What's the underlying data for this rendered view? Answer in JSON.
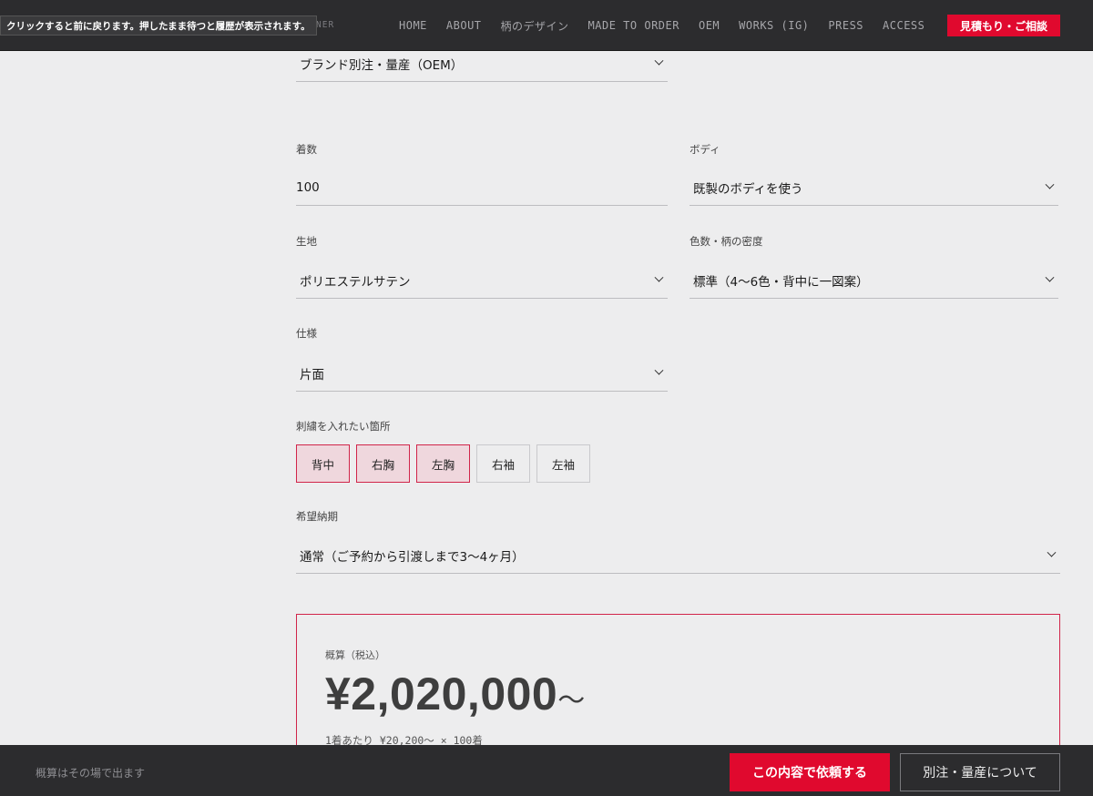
{
  "tooltip": "クリックすると前に戻ります。押したまま待つと履歴が表示されます。",
  "brand_tail": "N DESIGNER",
  "nav": {
    "items": [
      {
        "label": "HOME"
      },
      {
        "label": "ABOUT"
      },
      {
        "label": "柄のデザイン"
      },
      {
        "label": "MADE TO ORDER"
      },
      {
        "label": "OEM"
      },
      {
        "label": "WORKS (IG)"
      },
      {
        "label": "PRESS"
      },
      {
        "label": "ACCESS"
      }
    ],
    "cta": "見積もり・ご相談"
  },
  "form": {
    "order_type": {
      "value": "ブランド別注・量産（OEM）"
    },
    "quantity": {
      "label": "着数",
      "value": "100"
    },
    "body": {
      "label": "ボディ",
      "value": "既製のボディを使う"
    },
    "fabric": {
      "label": "生地",
      "value": "ポリエステルサテン"
    },
    "colors": {
      "label": "色数・柄の密度",
      "value": "標準（4〜6色・背中に一図案）"
    },
    "spec": {
      "label": "仕様",
      "value": "片面"
    },
    "embroidery": {
      "label": "刺繍を入れたい箇所",
      "options": [
        {
          "label": "背中",
          "selected": true
        },
        {
          "label": "右胸",
          "selected": true
        },
        {
          "label": "左胸",
          "selected": true
        },
        {
          "label": "右袖",
          "selected": false
        },
        {
          "label": "左袖",
          "selected": false
        }
      ]
    },
    "delivery": {
      "label": "希望納期",
      "value": "通常（ご予約から引渡しまで3〜4ヶ月）"
    }
  },
  "estimate": {
    "label": "概算（税込）",
    "price": "¥2,020,000",
    "price_suffix": "〜",
    "per_unit": "1着あたり ¥20,200〜 × 100着"
  },
  "bottom": {
    "note": "概算はその場で出ます",
    "request_button": "この内容で依頼する",
    "about_button": "別注・量産について"
  },
  "colors": {
    "accent": "#e0092e",
    "selected_chip_bg": "#efd7dd",
    "bar_bg": "#2c2c2e",
    "page_bg": "#ededee"
  }
}
